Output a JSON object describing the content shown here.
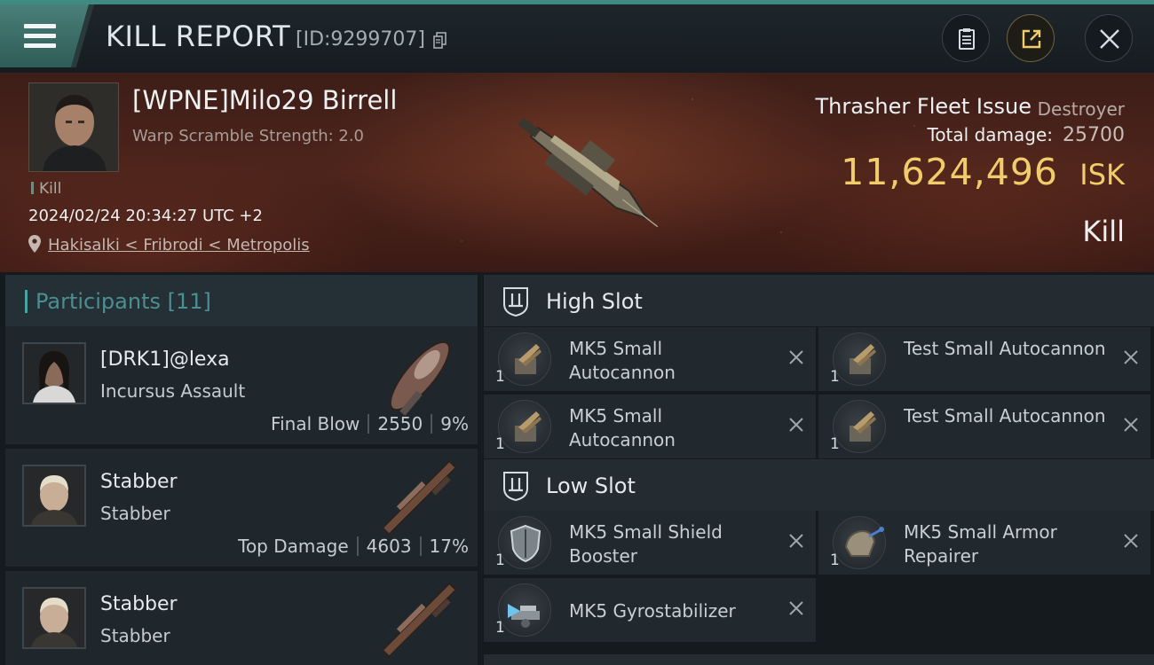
{
  "header": {
    "title": "KILL REPORT",
    "report_id": "[ID:9299707]",
    "icons": [
      "menu-icon",
      "copy-icon",
      "clipboard-icon",
      "share-icon",
      "close-icon"
    ]
  },
  "victim": {
    "name": "[WPNE]Milo29 Birrell",
    "warp_scramble": "Warp Scramble Strength: 2.0",
    "type_tag": "Kill",
    "datetime": "2024/02/24 20:34:27 UTC +2",
    "location": "Hakisalki < Fribrodi < Metropolis",
    "ship_name": "Thrasher Fleet Issue",
    "ship_class": "Destroyer",
    "total_damage_label": "Total damage:",
    "total_damage": "25700",
    "isk_value": "11,624,496",
    "isk_unit": "ISK",
    "result": "Kill"
  },
  "participants": {
    "title": "Participants [11]",
    "items": [
      {
        "name": "[DRK1]@lexa",
        "ship": "Incursus Assault",
        "tag": "Final Blow",
        "damage": "2550",
        "percent": "9%"
      },
      {
        "name": "Stabber",
        "ship": "Stabber",
        "tag": "Top Damage",
        "damage": "4603",
        "percent": "17%"
      },
      {
        "name": "Stabber",
        "ship": "Stabber"
      }
    ]
  },
  "fitting": {
    "high_slot": {
      "title": "High Slot",
      "modules": [
        {
          "name": "MK5 Small Autocannon",
          "qty": "1"
        },
        {
          "name": "Test Small Autocannon",
          "qty": "1"
        },
        {
          "name": "MK5 Small Autocannon",
          "qty": "1"
        },
        {
          "name": "Test Small Autocannon",
          "qty": "1"
        }
      ]
    },
    "low_slot": {
      "title": "Low Slot",
      "modules": [
        {
          "name": "MK5 Small Shield Booster",
          "qty": "1"
        },
        {
          "name": "MK5 Small Armor Repairer",
          "qty": "1"
        },
        {
          "name": "MK5 Gyrostabilizer",
          "qty": "1"
        }
      ]
    }
  },
  "colors": {
    "accent_teal": "#3f8a82",
    "isk_gold": "#f1cc6b",
    "participants_title": "#4a8f91"
  }
}
